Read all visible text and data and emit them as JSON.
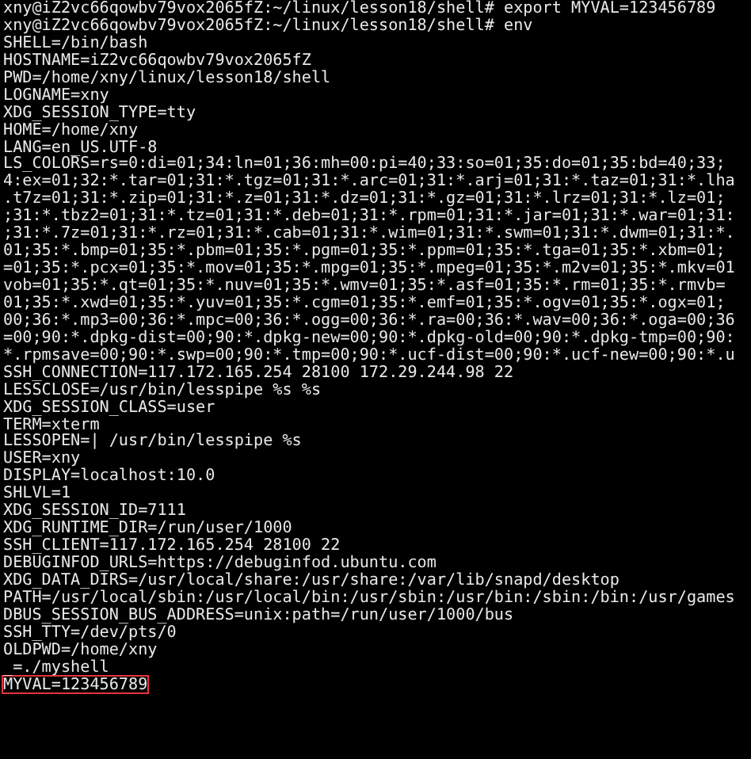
{
  "terminal": {
    "lines": [
      {
        "text": "xny@iZ2vc66qowbv79vox2065fZ:~/linux/lesson18/shell# export MYVAL=123456789",
        "highlighted": false
      },
      {
        "text": "xny@iZ2vc66qowbv79vox2065fZ:~/linux/lesson18/shell# env",
        "highlighted": false
      },
      {
        "text": "SHELL=/bin/bash",
        "highlighted": false
      },
      {
        "text": "HOSTNAME=iZ2vc66qowbv79vox2065fZ",
        "highlighted": false
      },
      {
        "text": "PWD=/home/xny/linux/lesson18/shell",
        "highlighted": false
      },
      {
        "text": "LOGNAME=xny",
        "highlighted": false
      },
      {
        "text": "XDG_SESSION_TYPE=tty",
        "highlighted": false
      },
      {
        "text": "HOME=/home/xny",
        "highlighted": false
      },
      {
        "text": "LANG=en_US.UTF-8",
        "highlighted": false
      },
      {
        "text": "LS_COLORS=rs=0:di=01;34:ln=01;36:mh=00:pi=40;33:so=01;35:do=01;35:bd=40;33;",
        "highlighted": false
      },
      {
        "text": "4:ex=01;32:*.tar=01;31:*.tgz=01;31:*.arc=01;31:*.arj=01;31:*.taz=01;31:*.lha",
        "highlighted": false
      },
      {
        "text": ".t7z=01;31:*.zip=01;31:*.z=01;31:*.dz=01;31:*.gz=01;31:*.lrz=01;31:*.lz=01;",
        "highlighted": false
      },
      {
        "text": ";31:*.tbz2=01;31:*.tz=01;31:*.deb=01;31:*.rpm=01;31:*.jar=01;31:*.war=01;31:",
        "highlighted": false
      },
      {
        "text": ";31:*.7z=01;31:*.rz=01;31:*.cab=01;31:*.wim=01;31:*.swm=01;31:*.dwm=01;31:*.",
        "highlighted": false
      },
      {
        "text": "01;35:*.bmp=01;35:*.pbm=01;35:*.pgm=01;35:*.ppm=01;35:*.tga=01;35:*.xbm=01;",
        "highlighted": false
      },
      {
        "text": "=01;35:*.pcx=01;35:*.mov=01;35:*.mpg=01;35:*.mpeg=01;35:*.m2v=01;35:*.mkv=01",
        "highlighted": false
      },
      {
        "text": "vob=01;35:*.qt=01;35:*.nuv=01;35:*.wmv=01;35:*.asf=01;35:*.rm=01;35:*.rmvb=",
        "highlighted": false
      },
      {
        "text": "01;35:*.xwd=01;35:*.yuv=01;35:*.cgm=01;35:*.emf=01;35:*.ogv=01;35:*.ogx=01;",
        "highlighted": false
      },
      {
        "text": "00;36:*.mp3=00;36:*.mpc=00;36:*.ogg=00;36:*.ra=00;36:*.wav=00;36:*.oga=00;36",
        "highlighted": false
      },
      {
        "text": "=00;90:*.dpkg-dist=00;90:*.dpkg-new=00;90:*.dpkg-old=00;90:*.dpkg-tmp=00;90:",
        "highlighted": false
      },
      {
        "text": "*.rpmsave=00;90:*.swp=00;90:*.tmp=00;90:*.ucf-dist=00;90:*.ucf-new=00;90:*.u",
        "highlighted": false
      },
      {
        "text": "SSH_CONNECTION=117.172.165.254 28100 172.29.244.98 22",
        "highlighted": false
      },
      {
        "text": "LESSCLOSE=/usr/bin/lesspipe %s %s",
        "highlighted": false
      },
      {
        "text": "XDG_SESSION_CLASS=user",
        "highlighted": false
      },
      {
        "text": "TERM=xterm",
        "highlighted": false
      },
      {
        "text": "LESSOPEN=| /usr/bin/lesspipe %s",
        "highlighted": false
      },
      {
        "text": "USER=xny",
        "highlighted": false
      },
      {
        "text": "DISPLAY=localhost:10.0",
        "highlighted": false
      },
      {
        "text": "SHLVL=1",
        "highlighted": false
      },
      {
        "text": "XDG_SESSION_ID=7111",
        "highlighted": false
      },
      {
        "text": "XDG_RUNTIME_DIR=/run/user/1000",
        "highlighted": false
      },
      {
        "text": "SSH_CLIENT=117.172.165.254 28100 22",
        "highlighted": false
      },
      {
        "text": "DEBUGINFOD_URLS=https://debuginfod.ubuntu.com",
        "highlighted": false
      },
      {
        "text": "XDG_DATA_DIRS=/usr/local/share:/usr/share:/var/lib/snapd/desktop",
        "highlighted": false
      },
      {
        "text": "PATH=/usr/local/sbin:/usr/local/bin:/usr/sbin:/usr/bin:/sbin:/bin:/usr/games",
        "highlighted": false
      },
      {
        "text": "DBUS_SESSION_BUS_ADDRESS=unix:path=/run/user/1000/bus",
        "highlighted": false
      },
      {
        "text": "SSH_TTY=/dev/pts/0",
        "highlighted": false
      },
      {
        "text": "OLDPWD=/home/xny",
        "highlighted": false
      },
      {
        "text": "_=./myshell",
        "highlighted": false
      },
      {
        "text": "MYVAL=123456789",
        "highlighted": true
      }
    ]
  }
}
